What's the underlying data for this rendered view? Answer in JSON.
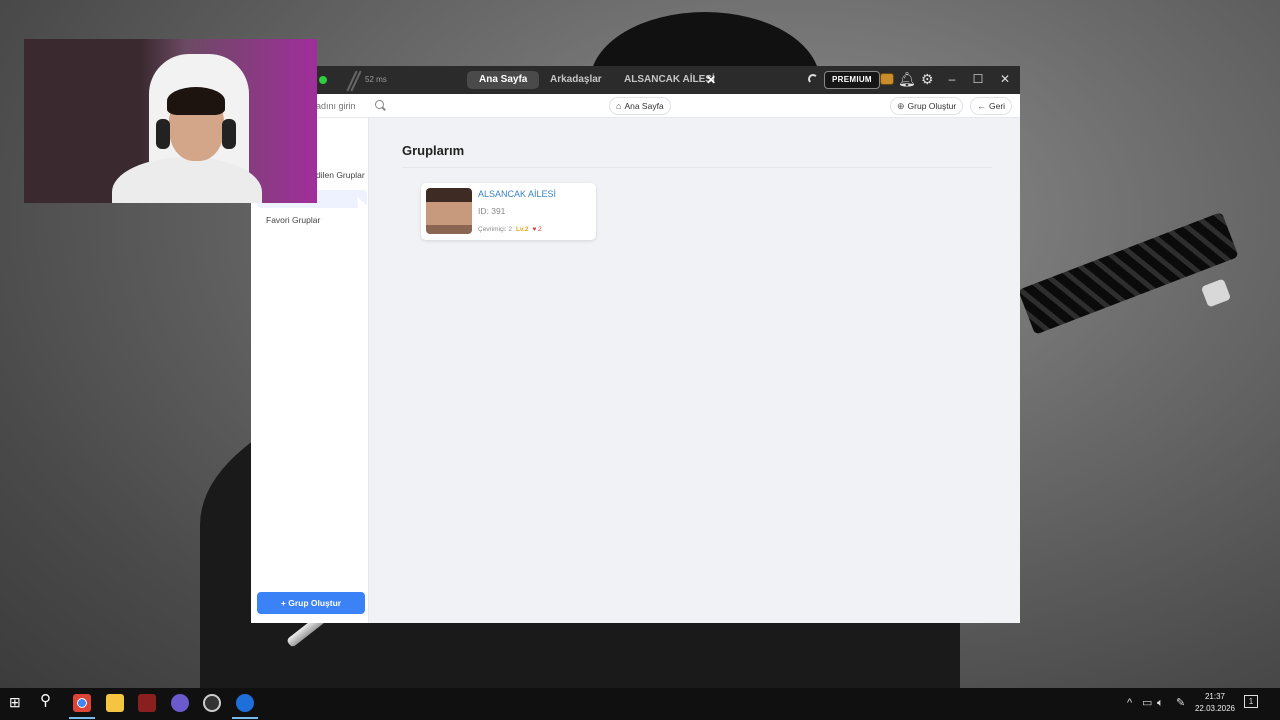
{
  "titlebar": {
    "ping": "52 ms",
    "tabs": [
      "Ana Sayfa",
      "Arkadaşlar",
      "ALSANCAK AİLESİ"
    ],
    "premium_label": "PREMIUM"
  },
  "toolbar": {
    "search_placeholder": "adını girin",
    "home_label": "Ana Sayfa",
    "create_label": "Grup Oluştur",
    "back_label": "Geri"
  },
  "sidebar": {
    "items": [
      "dilen Gruplar",
      "Favori Gruplar"
    ],
    "create_button": "+ Grup Oluştur"
  },
  "main": {
    "title": "Gruplarım",
    "groups": [
      {
        "name": "ALSANCAK AİLESİ",
        "id_text": "ID: 391",
        "online": "Çevrimiçi: 2",
        "level": "Lv.2",
        "likes": "2"
      }
    ]
  },
  "taskbar": {
    "time": "21:37",
    "date": "22.03.2026",
    "notification_count": "1"
  },
  "colors": {
    "accent": "#3b82f6",
    "link": "#3b82c4",
    "online_dot": "#2ecc40",
    "level": "#e8a317",
    "heart": "#e53935"
  }
}
